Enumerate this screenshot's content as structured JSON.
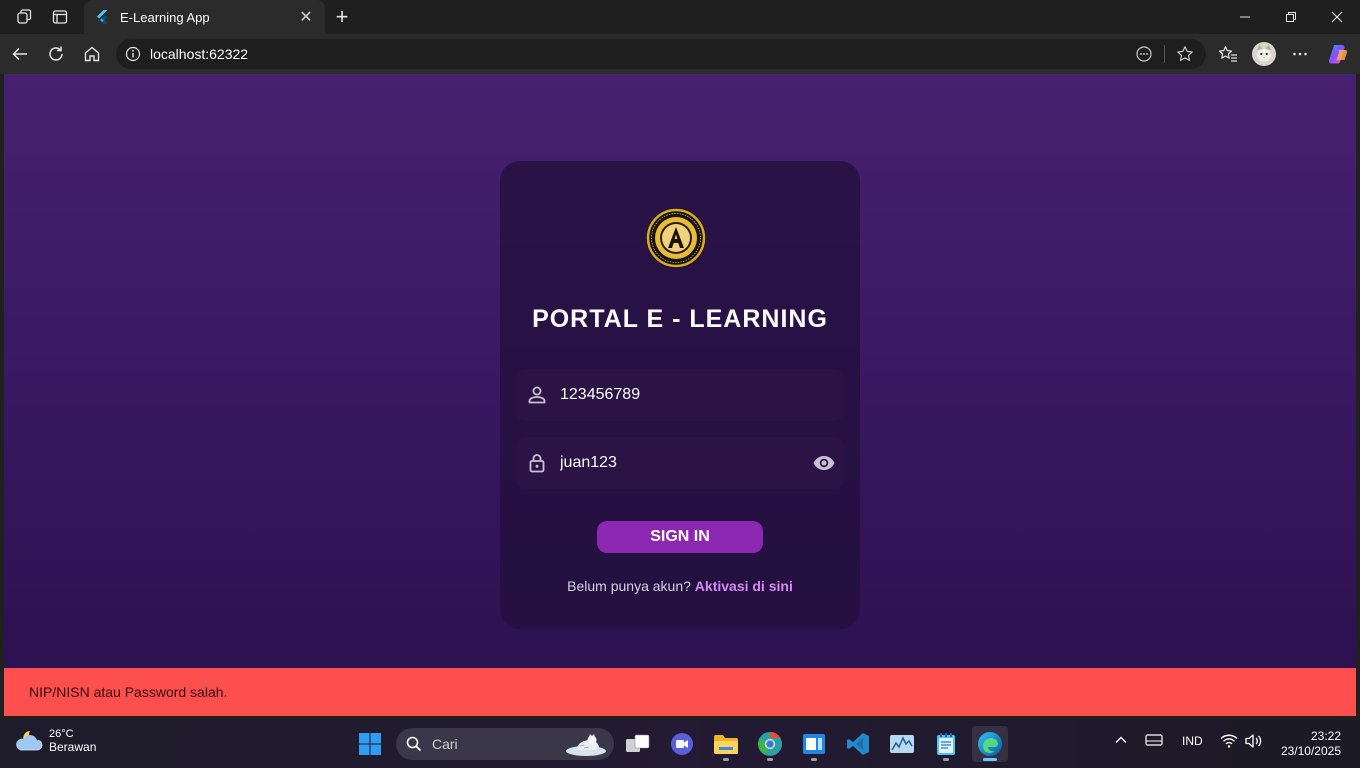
{
  "browser": {
    "tab_title": "E-Learning App",
    "url": "localhost:62322"
  },
  "login": {
    "title": "PORTAL E - LEARNING",
    "username_value": "123456789",
    "password_value": "juan123",
    "signin_label": "SIGN IN",
    "signup_prompt": "Belum punya akun?",
    "signup_link": "Aktivasi di sini"
  },
  "snackbar": {
    "message": "NIP/NISN atau Password salah."
  },
  "taskbar": {
    "weather_temp": "26°C",
    "weather_condition": "Berawan",
    "search_placeholder": "Cari",
    "language": "IND",
    "time": "23:22",
    "date": "23/10/2025"
  },
  "colors": {
    "page_bg": "#47216f",
    "card_bg": "#230f3c",
    "button": "#8b27b0",
    "link": "#d48bf0",
    "snackbar": "#fe4f4f"
  }
}
